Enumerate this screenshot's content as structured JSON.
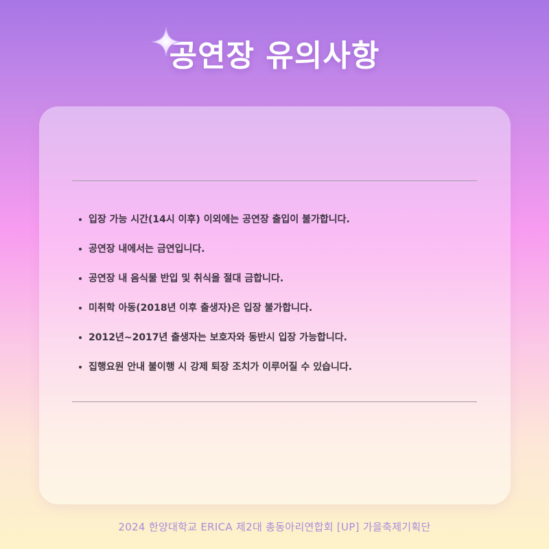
{
  "header": {
    "title": "공연장 유의사항",
    "sparkle_icon": "sparkle-icon"
  },
  "rules": [
    "입장 가능 시간(14시 이후) 이외에는 공연장 출입이 불가합니다.",
    "공연장 내에서는 금연입니다.",
    "공연장 내 음식물 반입 및 취식을 절대 금합니다.",
    "미취학 아동(2018년 이후 출생자)은 입장 불가합니다.",
    "2012년~2017년 출생자는 보호자와 동반시 입장 가능합니다.",
    "집행요원 안내 불이행 시 강제 퇴장 조치가 이루어질 수 있습니다."
  ],
  "footer": {
    "text": "2024 한양대학교 ERICA 제2대 총동아리연합회 [UP] 가을축제기획단"
  },
  "colors": {
    "title": "#ffffff",
    "body_text": "#3b3440",
    "footer_text": "#a78bdc",
    "gradient_top": "#a876e6",
    "gradient_mid": "#f89cf0",
    "gradient_bottom": "#fdf3c8"
  }
}
